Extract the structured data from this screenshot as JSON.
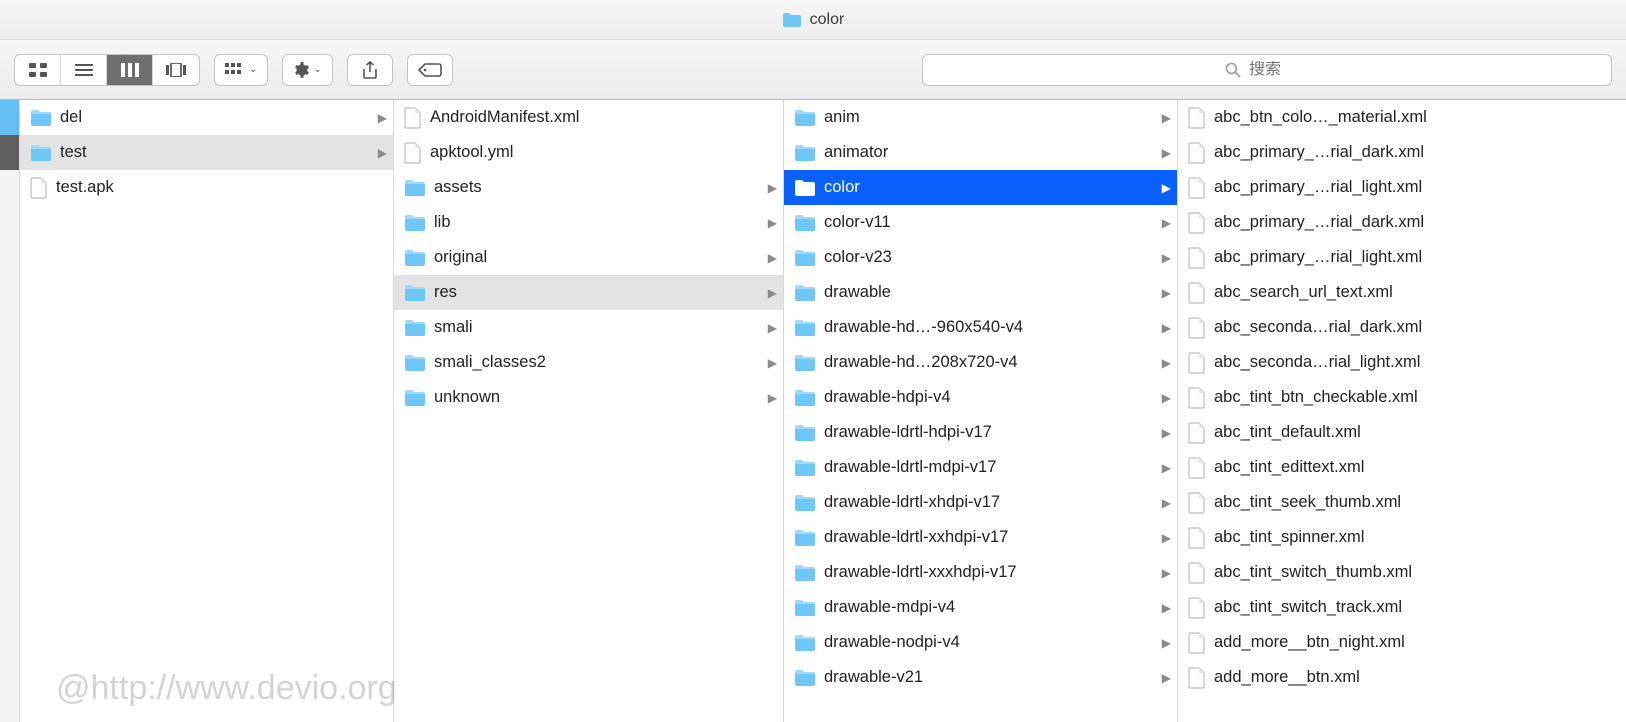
{
  "title": "color",
  "search": {
    "placeholder": "搜索"
  },
  "watermark": "@http://www.devio.org",
  "sidebar_tags": [
    {
      "selected": false
    },
    {
      "selected": true
    }
  ],
  "columns": [
    {
      "items": [
        {
          "label": "del",
          "type": "folder",
          "hasChildren": true,
          "state": "none"
        },
        {
          "label": "test",
          "type": "folder",
          "hasChildren": true,
          "state": "path"
        },
        {
          "label": "test.apk",
          "type": "file",
          "hasChildren": false,
          "state": "none"
        }
      ]
    },
    {
      "items": [
        {
          "label": "AndroidManifest.xml",
          "type": "file",
          "hasChildren": false,
          "state": "none"
        },
        {
          "label": "apktool.yml",
          "type": "file",
          "hasChildren": false,
          "state": "none"
        },
        {
          "label": "assets",
          "type": "folder",
          "hasChildren": true,
          "state": "none"
        },
        {
          "label": "lib",
          "type": "folder",
          "hasChildren": true,
          "state": "none"
        },
        {
          "label": "original",
          "type": "folder",
          "hasChildren": true,
          "state": "none"
        },
        {
          "label": "res",
          "type": "folder",
          "hasChildren": true,
          "state": "path"
        },
        {
          "label": "smali",
          "type": "folder",
          "hasChildren": true,
          "state": "none"
        },
        {
          "label": "smali_classes2",
          "type": "folder",
          "hasChildren": true,
          "state": "none"
        },
        {
          "label": "unknown",
          "type": "folder",
          "hasChildren": true,
          "state": "none"
        }
      ]
    },
    {
      "items": [
        {
          "label": "anim",
          "type": "folder",
          "hasChildren": true,
          "state": "none"
        },
        {
          "label": "animator",
          "type": "folder",
          "hasChildren": true,
          "state": "none"
        },
        {
          "label": "color",
          "type": "folder",
          "hasChildren": true,
          "state": "active"
        },
        {
          "label": "color-v11",
          "type": "folder",
          "hasChildren": true,
          "state": "none"
        },
        {
          "label": "color-v23",
          "type": "folder",
          "hasChildren": true,
          "state": "none"
        },
        {
          "label": "drawable",
          "type": "folder",
          "hasChildren": true,
          "state": "none"
        },
        {
          "label": "drawable-hd…-960x540-v4",
          "type": "folder",
          "hasChildren": true,
          "state": "none"
        },
        {
          "label": "drawable-hd…208x720-v4",
          "type": "folder",
          "hasChildren": true,
          "state": "none"
        },
        {
          "label": "drawable-hdpi-v4",
          "type": "folder",
          "hasChildren": true,
          "state": "none"
        },
        {
          "label": "drawable-ldrtl-hdpi-v17",
          "type": "folder",
          "hasChildren": true,
          "state": "none"
        },
        {
          "label": "drawable-ldrtl-mdpi-v17",
          "type": "folder",
          "hasChildren": true,
          "state": "none"
        },
        {
          "label": "drawable-ldrtl-xhdpi-v17",
          "type": "folder",
          "hasChildren": true,
          "state": "none"
        },
        {
          "label": "drawable-ldrtl-xxhdpi-v17",
          "type": "folder",
          "hasChildren": true,
          "state": "none"
        },
        {
          "label": "drawable-ldrtl-xxxhdpi-v17",
          "type": "folder",
          "hasChildren": true,
          "state": "none"
        },
        {
          "label": "drawable-mdpi-v4",
          "type": "folder",
          "hasChildren": true,
          "state": "none"
        },
        {
          "label": "drawable-nodpi-v4",
          "type": "folder",
          "hasChildren": true,
          "state": "none"
        },
        {
          "label": "drawable-v21",
          "type": "folder",
          "hasChildren": true,
          "state": "none"
        }
      ]
    },
    {
      "items": [
        {
          "label": "abc_btn_colo…_material.xml",
          "type": "file",
          "hasChildren": false,
          "state": "none"
        },
        {
          "label": "abc_primary_…rial_dark.xml",
          "type": "file",
          "hasChildren": false,
          "state": "none"
        },
        {
          "label": "abc_primary_…rial_light.xml",
          "type": "file",
          "hasChildren": false,
          "state": "none"
        },
        {
          "label": "abc_primary_…rial_dark.xml",
          "type": "file",
          "hasChildren": false,
          "state": "none"
        },
        {
          "label": "abc_primary_…rial_light.xml",
          "type": "file",
          "hasChildren": false,
          "state": "none"
        },
        {
          "label": "abc_search_url_text.xml",
          "type": "file",
          "hasChildren": false,
          "state": "none"
        },
        {
          "label": "abc_seconda…rial_dark.xml",
          "type": "file",
          "hasChildren": false,
          "state": "none"
        },
        {
          "label": "abc_seconda…rial_light.xml",
          "type": "file",
          "hasChildren": false,
          "state": "none"
        },
        {
          "label": "abc_tint_btn_checkable.xml",
          "type": "file",
          "hasChildren": false,
          "state": "none"
        },
        {
          "label": "abc_tint_default.xml",
          "type": "file",
          "hasChildren": false,
          "state": "none"
        },
        {
          "label": "abc_tint_edittext.xml",
          "type": "file",
          "hasChildren": false,
          "state": "none"
        },
        {
          "label": "abc_tint_seek_thumb.xml",
          "type": "file",
          "hasChildren": false,
          "state": "none"
        },
        {
          "label": "abc_tint_spinner.xml",
          "type": "file",
          "hasChildren": false,
          "state": "none"
        },
        {
          "label": "abc_tint_switch_thumb.xml",
          "type": "file",
          "hasChildren": false,
          "state": "none"
        },
        {
          "label": "abc_tint_switch_track.xml",
          "type": "file",
          "hasChildren": false,
          "state": "none"
        },
        {
          "label": "add_more__btn_night.xml",
          "type": "file",
          "hasChildren": false,
          "state": "none"
        },
        {
          "label": "add_more__btn.xml",
          "type": "file",
          "hasChildren": false,
          "state": "none"
        }
      ]
    }
  ]
}
